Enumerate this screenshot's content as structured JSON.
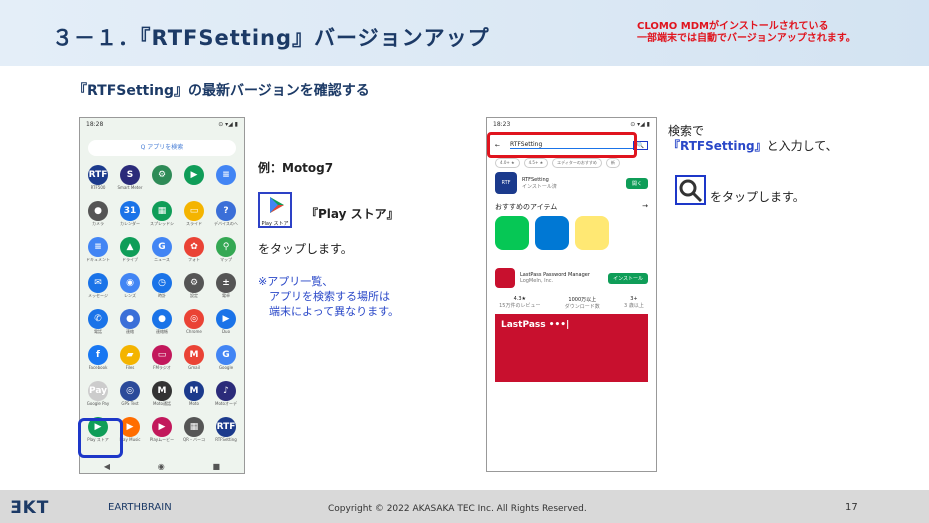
{
  "header": {
    "title": "３－１．『RTFSetting』バージョンアップ",
    "note_line1": "CLOMO MDMがインストールされている",
    "note_line2": "一部端末では自動でバージョンアップされます。"
  },
  "subtitle": "『RTFSetting』の最新バージョンを確認する",
  "phone1": {
    "time": "18:28",
    "search": "Q アプリを検索",
    "apps": [
      {
        "label": "RTF500",
        "color": "#1b3a8c",
        "glyph": "RTF"
      },
      {
        "label": "Smart Meter",
        "color": "#2b2b7a",
        "glyph": "S"
      },
      {
        "label": "",
        "color": "#2e8b57",
        "glyph": "⚙"
      },
      {
        "label": "",
        "color": "#0f9d58",
        "glyph": "▶"
      },
      {
        "label": "",
        "color": "#4285f4",
        "glyph": "≡"
      },
      {
        "label": "カメラ",
        "color": "#555",
        "glyph": "●"
      },
      {
        "label": "カレンダー",
        "color": "#1a73e8",
        "glyph": "31"
      },
      {
        "label": "スプレッドシ",
        "color": "#0f9d58",
        "glyph": "▦"
      },
      {
        "label": "スライド",
        "color": "#f4b400",
        "glyph": "▭"
      },
      {
        "label": "デバイスのヘ",
        "color": "#3b6fd8",
        "glyph": "?"
      },
      {
        "label": "ドキュメント",
        "color": "#4285f4",
        "glyph": "≡"
      },
      {
        "label": "ドライブ",
        "color": "#0f9d58",
        "glyph": "▲"
      },
      {
        "label": "ニュース",
        "color": "#4285f4",
        "glyph": "G"
      },
      {
        "label": "フォト",
        "color": "#ea4335",
        "glyph": "✿"
      },
      {
        "label": "マップ",
        "color": "#34a853",
        "glyph": "⚲"
      },
      {
        "label": "メッセージ",
        "color": "#1a73e8",
        "glyph": "✉"
      },
      {
        "label": "レンズ",
        "color": "#4285f4",
        "glyph": "◉"
      },
      {
        "label": "時計",
        "color": "#1a73e8",
        "glyph": "◷"
      },
      {
        "label": "設定",
        "color": "#555",
        "glyph": "⚙"
      },
      {
        "label": "電卓",
        "color": "#555",
        "glyph": "±"
      },
      {
        "label": "電話",
        "color": "#1a73e8",
        "glyph": "✆"
      },
      {
        "label": "連絡",
        "color": "#3b6fd8",
        "glyph": "●"
      },
      {
        "label": "連絡帳",
        "color": "#1a73e8",
        "glyph": "●"
      },
      {
        "label": "Chrome",
        "color": "#ea4335",
        "glyph": "◎"
      },
      {
        "label": "Duo",
        "color": "#1a73e8",
        "glyph": "▶"
      },
      {
        "label": "Facebook",
        "color": "#1877f2",
        "glyph": "f"
      },
      {
        "label": "Files",
        "color": "#f4b400",
        "glyph": "▰"
      },
      {
        "label": "FMラジオ",
        "color": "#c2185b",
        "glyph": "▭"
      },
      {
        "label": "Gmail",
        "color": "#ea4335",
        "glyph": "M"
      },
      {
        "label": "Google",
        "color": "#4285f4",
        "glyph": "G"
      },
      {
        "label": "Google Pay",
        "color": "#ccc",
        "glyph": "Pay"
      },
      {
        "label": "GPS Test",
        "color": "#2b4a9a",
        "glyph": "◎"
      },
      {
        "label": "Moto通話",
        "color": "#333",
        "glyph": "M"
      },
      {
        "label": "Moto",
        "color": "#1b3a8c",
        "glyph": "M"
      },
      {
        "label": "Motoオーデ",
        "color": "#2b2b7a",
        "glyph": "♪"
      },
      {
        "label": "Play ストア",
        "color": "#0f9d58",
        "glyph": "▶"
      },
      {
        "label": "Play Music",
        "color": "#ff6d00",
        "glyph": "▶"
      },
      {
        "label": "Playムービー",
        "color": "#c2185b",
        "glyph": "▶"
      },
      {
        "label": "QR・バーコ",
        "color": "#555",
        "glyph": "▦"
      },
      {
        "label": "RTFSetting",
        "color": "#1b3a8c",
        "glyph": "RTF"
      }
    ]
  },
  "mid": {
    "example": "例：Motog7",
    "ps_icon_label": "Play ストア",
    "playstore": "『Play ストア』",
    "tap": "をタップします。",
    "note": "※アプリ一覧、\n　アプリを検索する場所は\n　端末によって異なります。"
  },
  "phone2": {
    "time": "18:23",
    "query": "RTFSetting",
    "chips": [
      "4.0+ ★",
      "4.5+ ★",
      "エディターのおすすめ",
      "新"
    ],
    "app_name": "RTFSetting",
    "app_sub": "インストール済",
    "open": "開く",
    "section": "おすすめのアイテム",
    "lastpass": "LastPass Password Manager",
    "lastpass_sub": "LogMeIn, Inc.",
    "install": "インストール",
    "stats": [
      "4.3★",
      "1000万以上",
      "3+"
    ],
    "stats_sub": [
      "15万件のレビュー",
      "ダウンロード数",
      "3 歳以上"
    ],
    "banner": "LastPass •••|"
  },
  "right": {
    "line1": "検索で",
    "line2_name": "『RTFSetting』",
    "line2_rest": "と入力して、",
    "tap": "をタップします。"
  },
  "footer": {
    "logo": "ƎKT",
    "brain": "EARTHBRAIN",
    "copyright": "Copyright © 2022 AKASAKA TEC Inc. All Rights Reserved.",
    "page": "17"
  }
}
